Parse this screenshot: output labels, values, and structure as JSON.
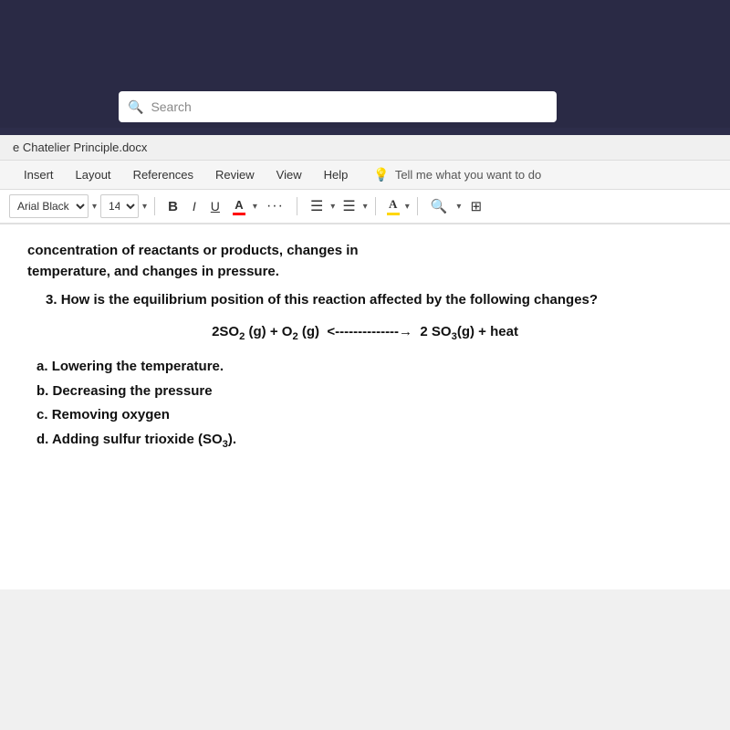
{
  "screen": {
    "background_color": "#2a2a45"
  },
  "search_bar": {
    "placeholder": "Search",
    "icon": "search-icon"
  },
  "title_bar": {
    "filename": "e Chatelier Principle.docx"
  },
  "menu": {
    "items": [
      {
        "label": "Insert",
        "id": "insert"
      },
      {
        "label": "Layout",
        "id": "layout"
      },
      {
        "label": "References",
        "id": "references"
      },
      {
        "label": "Review",
        "id": "review"
      },
      {
        "label": "View",
        "id": "view"
      },
      {
        "label": "Help",
        "id": "help"
      }
    ],
    "search_placeholder": "Tell me what you want to do"
  },
  "toolbar": {
    "font_name": "Arial Black",
    "font_size": "14",
    "bold_label": "B",
    "italic_label": "I",
    "underline_label": "U",
    "font_color_label": "A",
    "ellipsis_label": "···",
    "list_icon": "≡",
    "indent_icon": "≡",
    "highlight_label": "A",
    "search_icon": "🔍",
    "view_icon": "⊞"
  },
  "document": {
    "partial_line": "concentration of reactants or products, changes in",
    "bold_line": "temperature, and changes in pressure.",
    "question_number": "3.",
    "question_text": "How is the equilibrium position of this reaction affected by the following changes?",
    "reaction": "2SO₂ (g) + O₂ (g)  <---------------→  2 SO₃(g) + heat",
    "answers": [
      {
        "label": "a.",
        "text": "Lowering the temperature."
      },
      {
        "label": "b.",
        "text": "Decreasing the pressure"
      },
      {
        "label": "c.",
        "text": "Removing oxygen"
      },
      {
        "label": "d.",
        "text": "Adding sulfur trioxide (SO₃)."
      }
    ]
  }
}
